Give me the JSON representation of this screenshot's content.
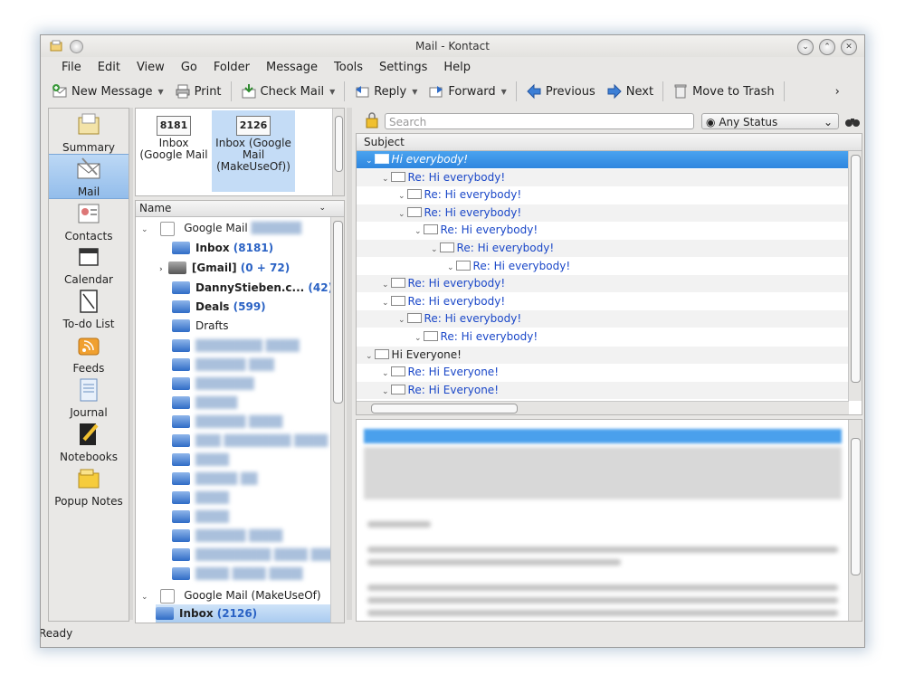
{
  "window": {
    "title": "Mail - Kontact"
  },
  "menu": [
    "File",
    "Edit",
    "View",
    "Go",
    "Folder",
    "Message",
    "Tools",
    "Settings",
    "Help"
  ],
  "toolbar": {
    "new_message": "New Message",
    "print": "Print",
    "check_mail": "Check Mail",
    "reply": "Reply",
    "forward": "Forward",
    "previous": "Previous",
    "next": "Next",
    "move_to_trash": "Move to Trash",
    "overflow": "›"
  },
  "sidebar": {
    "items": [
      {
        "label": "Summary",
        "icon": "summary-icon"
      },
      {
        "label": "Mail",
        "icon": "mail-icon",
        "active": true
      },
      {
        "label": "Contacts",
        "icon": "contacts-icon"
      },
      {
        "label": "Calendar",
        "icon": "calendar-icon"
      },
      {
        "label": "To-do List",
        "icon": "todo-icon"
      },
      {
        "label": "Feeds",
        "icon": "feeds-icon"
      },
      {
        "label": "Journal",
        "icon": "journal-icon"
      },
      {
        "label": "Notebooks",
        "icon": "notebooks-icon"
      },
      {
        "label": "Popup Notes",
        "icon": "popup-notes-icon"
      }
    ]
  },
  "favorites": [
    {
      "count": "8181",
      "label": "Inbox (Google Mail"
    },
    {
      "count": "2126",
      "label": "Inbox (Google Mail (MakeUseOf))"
    }
  ],
  "tree": {
    "header": "Name",
    "account1": "Google Mail",
    "account2": "Google Mail (MakeUseOf)",
    "folders": [
      {
        "name": "Inbox",
        "count": "(8181)",
        "bold": true
      },
      {
        "name": "[Gmail]",
        "count": "(0 + 72)",
        "bold": true
      },
      {
        "name": "DannyStieben.c...",
        "count": "(42)",
        "bold": true
      },
      {
        "name": "Deals",
        "count": "(599)",
        "bold": true
      },
      {
        "name": "Drafts",
        "count": "",
        "bold": false
      }
    ],
    "account2_inbox": {
      "name": "Inbox",
      "count": "(2126)"
    }
  },
  "search": {
    "placeholder": "Search",
    "status": "Any Status"
  },
  "messages": {
    "header": "Subject",
    "rows": [
      {
        "subject": "Hi everybody!",
        "indent": 0,
        "selected": true
      },
      {
        "subject": "Re: Hi everybody!",
        "indent": 1
      },
      {
        "subject": "Re: Hi everybody!",
        "indent": 2
      },
      {
        "subject": "Re: Hi everybody!",
        "indent": 2
      },
      {
        "subject": "Re: Hi everybody!",
        "indent": 3
      },
      {
        "subject": "Re: Hi everybody!",
        "indent": 4
      },
      {
        "subject": "Re: Hi everybody!",
        "indent": 5
      },
      {
        "subject": "Re: Hi everybody!",
        "indent": 1
      },
      {
        "subject": "Re: Hi everybody!",
        "indent": 1
      },
      {
        "subject": "Re: Hi everybody!",
        "indent": 2
      },
      {
        "subject": "Re: Hi everybody!",
        "indent": 3
      },
      {
        "subject": "Hi Everyone!",
        "indent": 0,
        "unread": true
      },
      {
        "subject": "Re: Hi Everyone!",
        "indent": 1
      },
      {
        "subject": "Re: Hi Everyone!",
        "indent": 1
      }
    ]
  },
  "statusbar": {
    "text": "Ready"
  }
}
